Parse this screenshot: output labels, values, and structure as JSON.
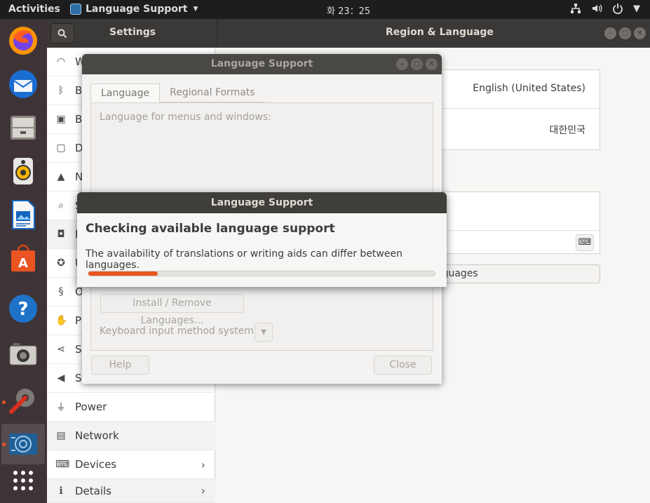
{
  "topbar": {
    "activities": "Activities",
    "app_name": "Language Support",
    "clock": "화 23：25",
    "icons": [
      "network-icon",
      "volume-icon",
      "power-icon",
      "dropdown-arrow-icon"
    ]
  },
  "dock": {
    "apps": [
      "firefox-icon",
      "thunderbird-icon",
      "files-icon",
      "rhythmbox-icon",
      "libreoffice-writer-icon",
      "ubuntu-software-icon",
      "help-icon",
      "screenshot-icon",
      "settings-icon",
      "language-support-icon",
      "show-apps-icon"
    ]
  },
  "settings": {
    "title": "Settings",
    "panel_title": "Region & Language",
    "sidebar": [
      {
        "label": "W",
        "icon": "wifi-icon"
      },
      {
        "label": "B",
        "icon": "bluetooth-icon"
      },
      {
        "label": "B",
        "icon": "background-icon"
      },
      {
        "label": "D",
        "icon": "dock-icon"
      },
      {
        "label": "N",
        "icon": "notifications-icon"
      },
      {
        "label": "S",
        "icon": "search-icon"
      },
      {
        "label": "R",
        "icon": "region-icon"
      },
      {
        "label": "U",
        "icon": "universal-access-icon"
      },
      {
        "label": "O",
        "icon": "online-accounts-icon"
      },
      {
        "label": "P",
        "icon": "privacy-icon"
      },
      {
        "label": "Sh",
        "icon": "sharing-icon"
      },
      {
        "label": "So",
        "icon": "sound-icon"
      },
      {
        "label": "Power",
        "icon": "power-icon"
      },
      {
        "label": "Network",
        "icon": "network-icon"
      },
      {
        "label": "Devices",
        "icon": "devices-icon"
      },
      {
        "label": "Details",
        "icon": "details-icon"
      }
    ],
    "language_value": "English (United States)",
    "formats_value": "대한민국",
    "manage_languages_partial": "l Languages"
  },
  "language_support": {
    "title": "Language Support",
    "tabs": [
      "Language",
      "Regional Formats"
    ],
    "menus_label": "Language for menus and windows:",
    "install_button": "Install / Remove Languages...",
    "keyboard_label": "Keyboard input method system:",
    "help_button": "Help",
    "close_button": "Close"
  },
  "dialog": {
    "title": "Language Support",
    "heading": "Checking available language support",
    "description": "The availability of translations or writing aids can differ between languages.",
    "progress_fraction": 0.2,
    "accent_color": "#e95420"
  }
}
